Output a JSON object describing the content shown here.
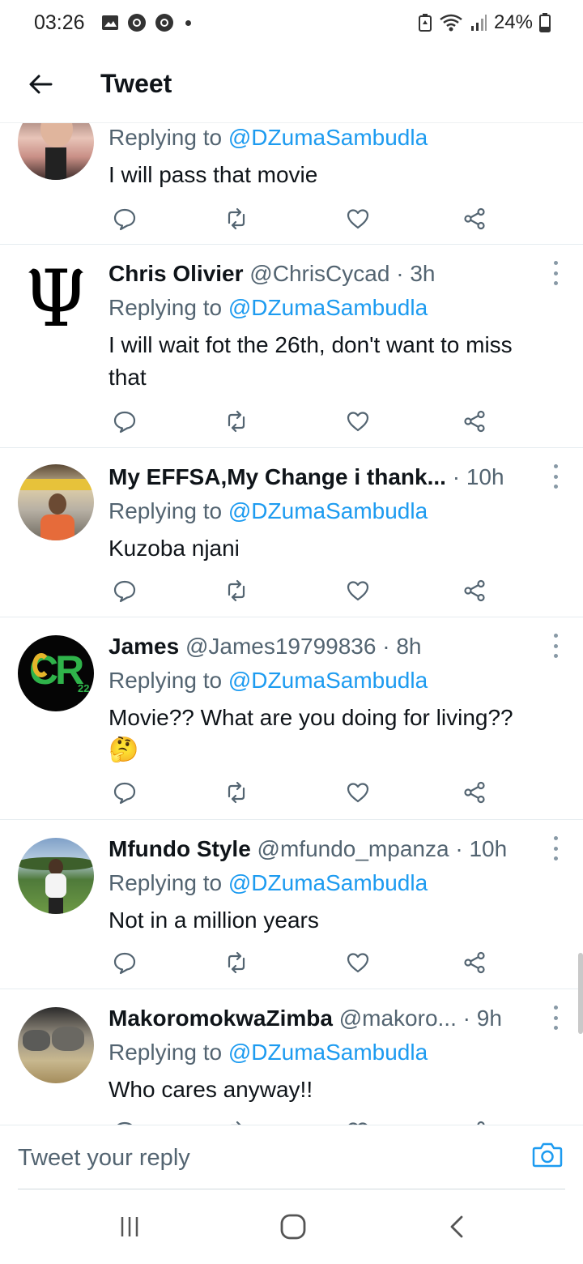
{
  "status_bar": {
    "time": "03:26",
    "battery": "24%"
  },
  "header": {
    "title": "Tweet"
  },
  "tweets": [
    {
      "name": "",
      "handle": "",
      "time": "",
      "replying_prefix": "Replying to ",
      "replying_to": "@DZumaSambudla",
      "text": "I will pass that movie"
    },
    {
      "name": "Chris Olivier",
      "handle": "@ChrisCycad",
      "time": "· 3h",
      "replying_prefix": "Replying to ",
      "replying_to": "@DZumaSambudla",
      "text": "I will wait fot the 26th, don't want to miss that",
      "avatar_glyph": "Ψ"
    },
    {
      "name": "My EFFSA,My Change i thank...",
      "handle": "",
      "time": "· 10h",
      "replying_prefix": "Replying to ",
      "replying_to": "@DZumaSambudla",
      "text": "Kuzoba njani"
    },
    {
      "name": "James",
      "handle": "@James19799836",
      "time": "· 8h",
      "replying_prefix": "Replying to ",
      "replying_to": "@DZumaSambudla",
      "text": "Movie?? What are you doing for living??",
      "emoji": "🤔",
      "avatar_text": "CR",
      "avatar_sub": "22"
    },
    {
      "name": "Mfundo Style",
      "handle": "@mfundo_mpanza",
      "time": "· 10h",
      "replying_prefix": "Replying to ",
      "replying_to": "@DZumaSambudla",
      "text": "Not in a million years"
    },
    {
      "name": "MakoromokwaZimba",
      "handle": "@makoro...",
      "time": "· 9h",
      "replying_prefix": "Replying to ",
      "replying_to": "@DZumaSambudla",
      "text": "Who cares anyway!!"
    }
  ],
  "reply_bar": {
    "placeholder": "Tweet your reply"
  },
  "colors": {
    "accent": "#1d9bf0",
    "secondary_text": "#536471",
    "primary_text": "#0f1419",
    "divider": "#e6ecf0"
  },
  "icons": [
    "back-arrow-icon",
    "reply-icon",
    "retweet-icon",
    "like-icon",
    "share-icon",
    "more-icon",
    "camera-icon",
    "recents-icon",
    "home-icon",
    "back-icon"
  ]
}
